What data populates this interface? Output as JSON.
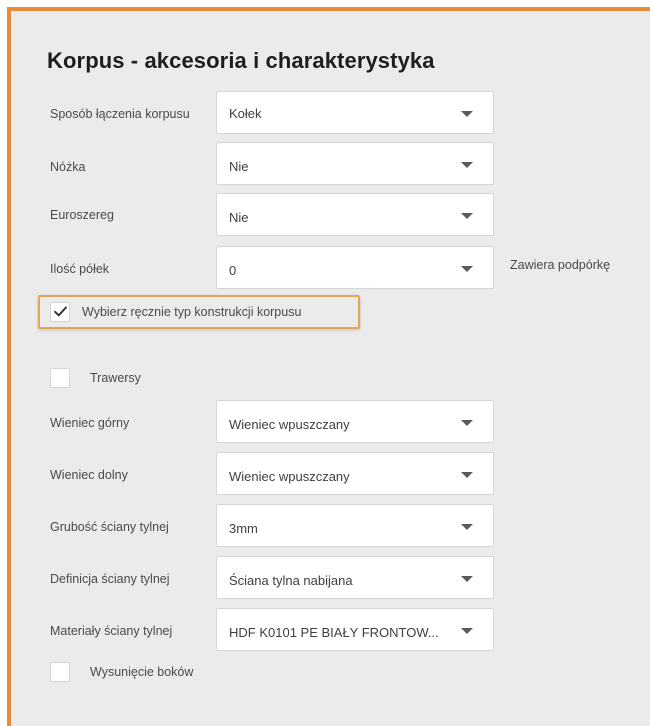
{
  "form": {
    "title": "Korpus - akcesoria i charakterystyka",
    "rows": [
      {
        "label": "Sposób łączenia korpusu",
        "value": "Kołek"
      },
      {
        "label": "Nóżka",
        "value": "Nie"
      },
      {
        "label": "Euroszereg",
        "value": "Nie"
      },
      {
        "label": "Ilość półek",
        "value": "0",
        "note": "Zawiera podpórkę"
      }
    ],
    "manual_checkbox": {
      "label": "Wybierz ręcznie typ konstrukcji korpusu",
      "checked": true
    },
    "trawersy_checkbox": {
      "label": "Trawersy",
      "checked": false
    },
    "rows2": [
      {
        "label": "Wieniec górny",
        "value": "Wieniec wpuszczany"
      },
      {
        "label": "Wieniec dolny",
        "value": "Wieniec wpuszczany"
      },
      {
        "label": "Grubość ściany tylnej",
        "value": "3mm"
      },
      {
        "label": "Definicja ściany tylnej",
        "value": "Ściana tylna nabijana"
      },
      {
        "label": "Materiały ściany tylnej",
        "value": "HDF K0101 PE BIAŁY FRONTOW..."
      }
    ],
    "wysuniecie_checkbox": {
      "label": "Wysunięcie boków",
      "checked": false
    }
  },
  "colors": {
    "accent_border": "#e88b3a",
    "highlight": "#e8a35a",
    "panel_bg": "#ebebeb"
  },
  "icons": {
    "dropdown": "chevron-down-icon",
    "check": "check-icon"
  }
}
